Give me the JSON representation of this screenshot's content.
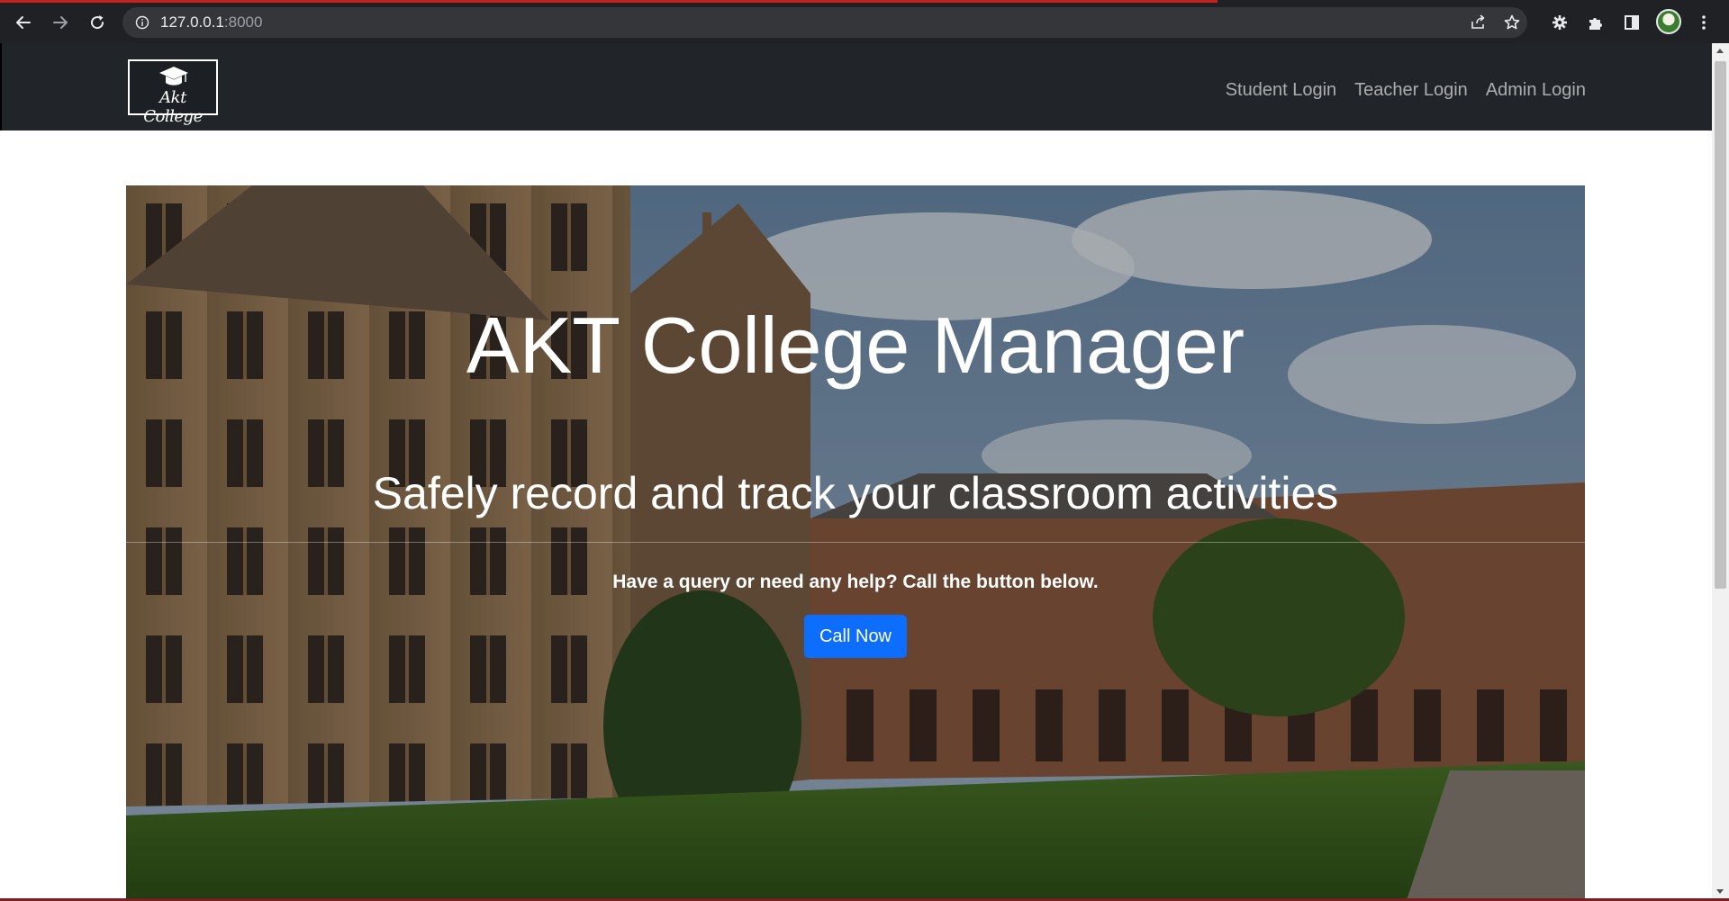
{
  "browser": {
    "url_host": "127.0.0.1",
    "url_port": ":8000"
  },
  "navbar": {
    "brand_text": "Akt College",
    "links": [
      {
        "label": "Student Login"
      },
      {
        "label": "Teacher Login"
      },
      {
        "label": "Admin Login"
      }
    ]
  },
  "hero": {
    "title": "AKT College Manager",
    "subtitle": "Safely record and track your classroom activities",
    "query_text": "Have a query or need any help? Call the button below.",
    "call_button_label": "Call Now"
  },
  "colors": {
    "navbar_bg": "#212529",
    "button_primary": "#0d6efd",
    "chrome_bg": "#202124",
    "loading_bar": "#c5221f"
  },
  "icons": {
    "back": "arrow-left-icon",
    "forward": "arrow-right-icon",
    "reload": "reload-icon",
    "site_info": "info-icon",
    "share": "share-icon",
    "bookmark": "star-icon",
    "extension": "gear-icon",
    "extensions": "puzzle-icon",
    "side_panel": "side-panel-icon",
    "menu": "kebab-menu-icon",
    "logo": "graduation-cap-icon"
  }
}
